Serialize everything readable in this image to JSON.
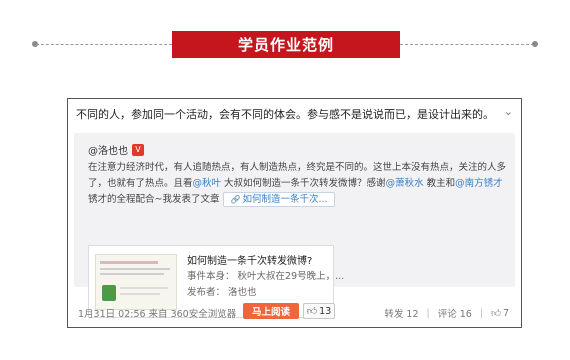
{
  "header": {
    "title": "学员作业范例"
  },
  "post": {
    "text": "不同的人，参加同一个活动，会有不同的体会。参与感不是说说而已，是设计出来的。",
    "repost": {
      "author": "@洛也也",
      "badge": "V",
      "line1": "在注意力经济时代，有人追随热点，有人制造热点，终究是不同的。这世上本没有热点，关注的人多",
      "line2_a": "了，也就有了热点。且看",
      "mention1": "@秋叶",
      "line2_b": " 大叔如何制造一条千次转发微博？感谢",
      "mention2": "@萧秋水",
      "line2_c": " 教主和",
      "mention3": "@南方锈才",
      "line3_a": "锈才的全程配合~我发表了文章",
      "topic_chip": "如何制造一条千次...",
      "article": {
        "title": "如何制造一条千次转发微博?",
        "event": "事件本身：  秋叶大叔在29号晚上，...",
        "publisher": "发布者：  洛也也",
        "read_button": "马上阅读",
        "like_count": "13"
      }
    },
    "footer": {
      "meta": "1月31日 02:56 来自 360安全浏览器",
      "repost": "转发 12",
      "comment": "评论 16",
      "like": "7"
    }
  }
}
